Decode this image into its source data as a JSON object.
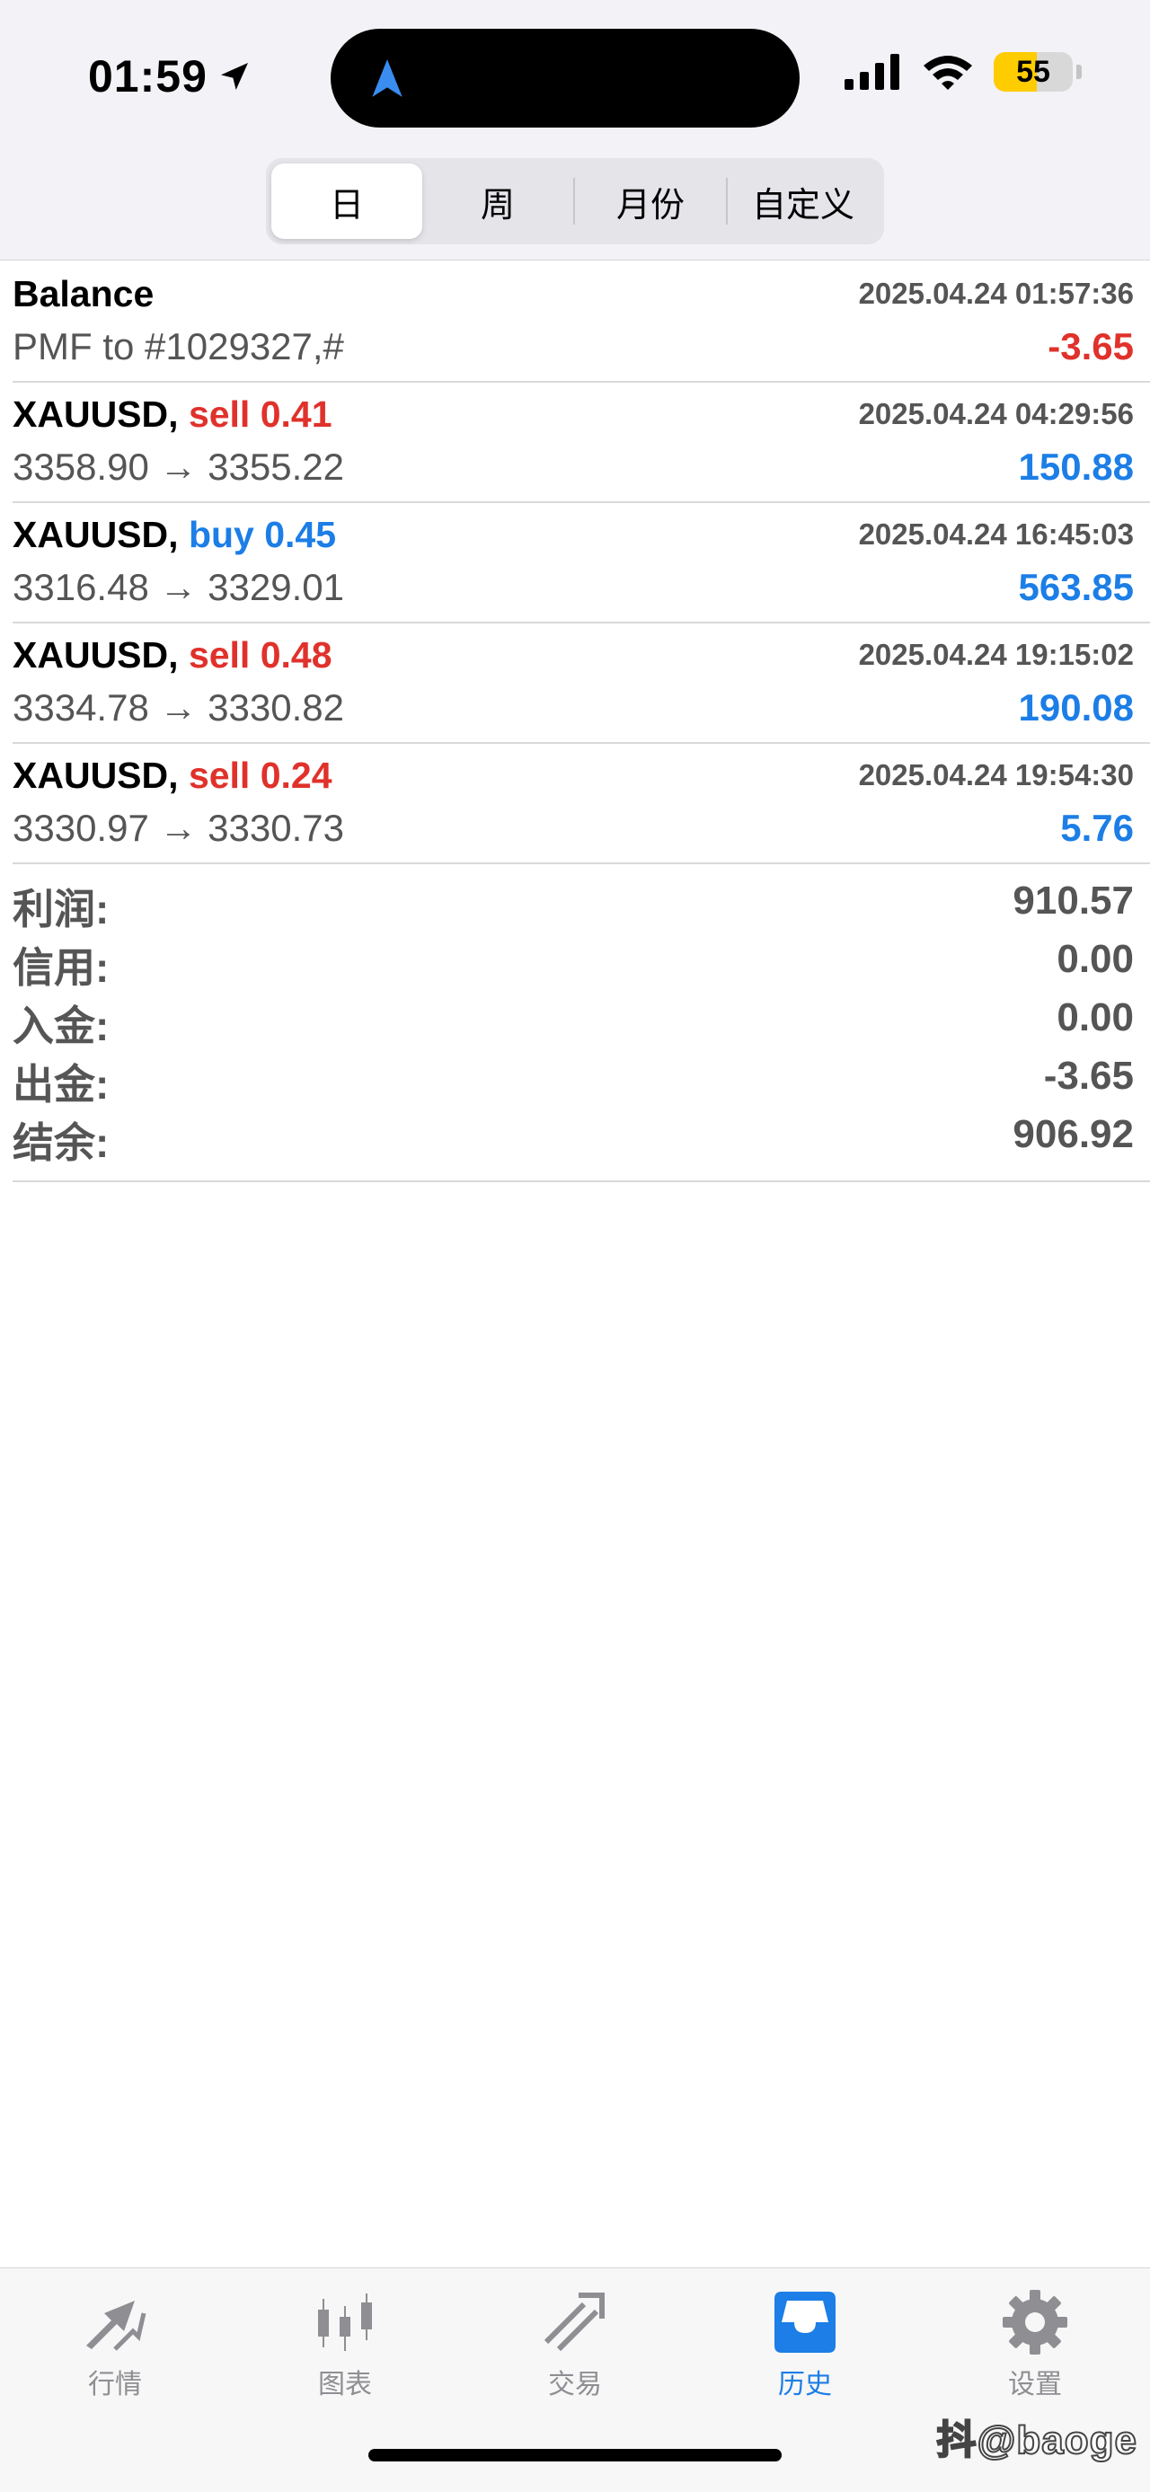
{
  "status": {
    "time": "01:59",
    "battery": "55",
    "battery_level": 0.55
  },
  "periods": [
    "日",
    "周",
    "月份",
    "自定义"
  ],
  "active_period": 0,
  "deals": [
    {
      "symbol": "Balance",
      "side": "",
      "time": "2025.04.24 01:57:36",
      "detail": "PMF to #1029327,#",
      "amount": "-3.65",
      "amount_color": "neg"
    },
    {
      "symbol": "XAUUSD,",
      "side": "sell 0.41",
      "side_color": "sell",
      "time": "2025.04.24 04:29:56",
      "detail": "3358.90 → 3355.22",
      "amount": "150.88",
      "amount_color": "pos"
    },
    {
      "symbol": "XAUUSD,",
      "side": "buy 0.45",
      "side_color": "buy",
      "time": "2025.04.24 16:45:03",
      "detail": "3316.48 → 3329.01",
      "amount": "563.85",
      "amount_color": "pos"
    },
    {
      "symbol": "XAUUSD,",
      "side": "sell 0.48",
      "side_color": "sell",
      "time": "2025.04.24 19:15:02",
      "detail": "3334.78 → 3330.82",
      "amount": "190.08",
      "amount_color": "pos"
    },
    {
      "symbol": "XAUUSD,",
      "side": "sell 0.24",
      "side_color": "sell",
      "time": "2025.04.24 19:54:30",
      "detail": "3330.97 → 3330.73",
      "amount": "5.76",
      "amount_color": "pos"
    }
  ],
  "summary": {
    "profit_label": "利润:",
    "profit": "910.57",
    "credit_label": "信用:",
    "credit": "0.00",
    "deposit_label": "入金:",
    "deposit": "0.00",
    "withdrawal_label": "出金:",
    "withdrawal": "-3.65",
    "balance_label": "结余:",
    "balance": "906.92"
  },
  "tabs": [
    {
      "label": "行情",
      "icon": "quotes-icon"
    },
    {
      "label": "图表",
      "icon": "chart-icon"
    },
    {
      "label": "交易",
      "icon": "trade-icon"
    },
    {
      "label": "历史",
      "icon": "history-icon"
    },
    {
      "label": "设置",
      "icon": "settings-icon"
    }
  ],
  "active_tab": 3,
  "watermark": "抖@baoge",
  "colors": {
    "sell": "#e0312b",
    "buy": "#1c7ee6",
    "accent": "#1c7ee6",
    "muted": "#555555"
  }
}
